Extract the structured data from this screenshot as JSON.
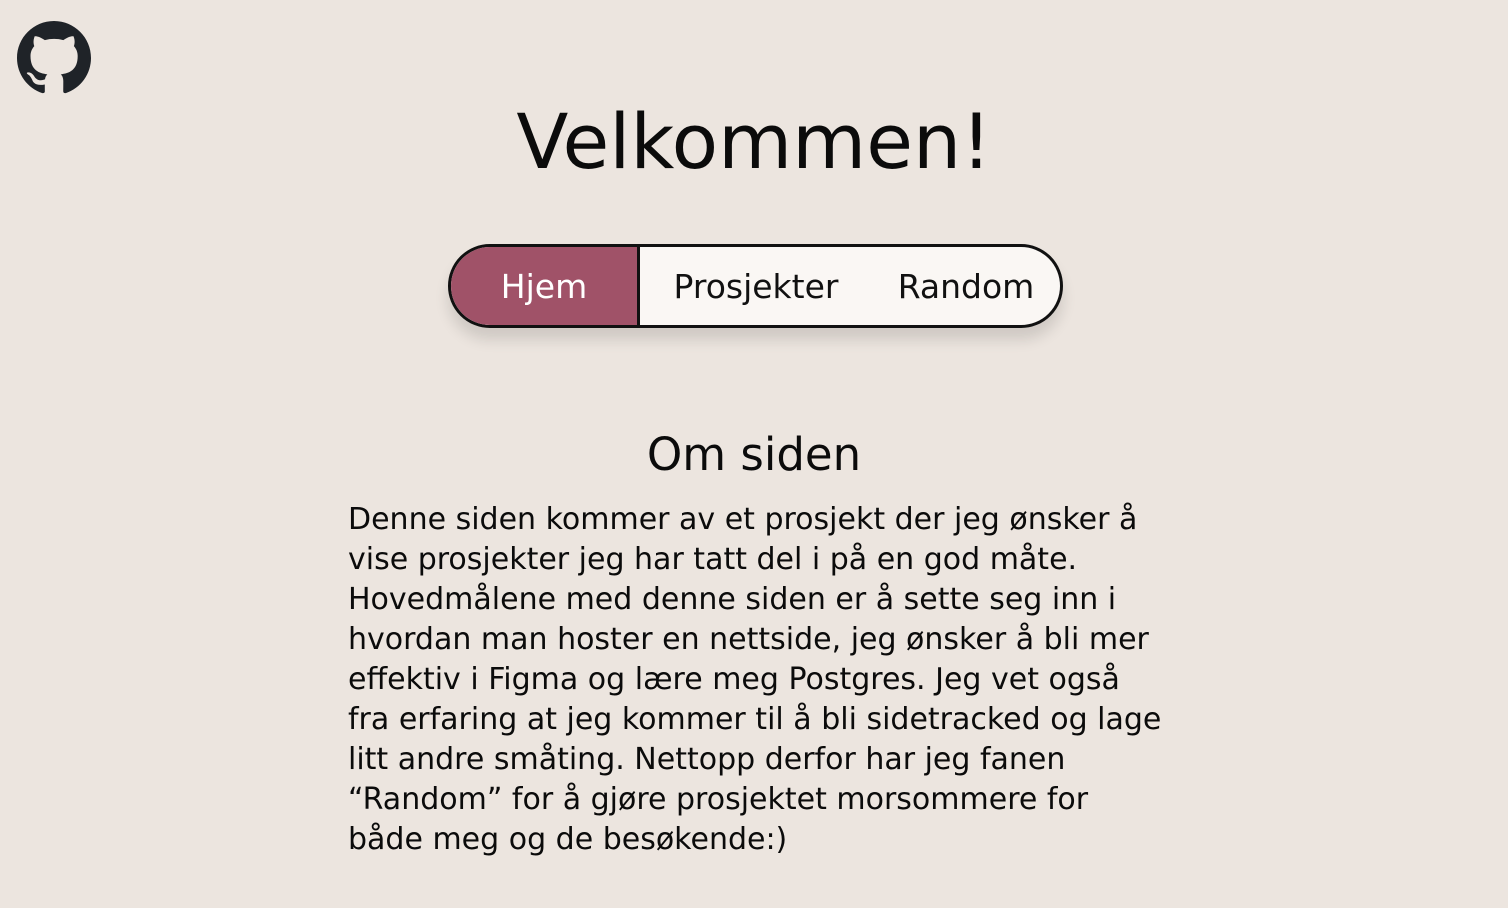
{
  "header": {
    "github_icon": "github-icon"
  },
  "page": {
    "title": "Velkommen!"
  },
  "nav": {
    "tabs": [
      {
        "label": "Hjem",
        "active": true
      },
      {
        "label": "Prosjekter",
        "active": false
      },
      {
        "label": "Random",
        "active": false
      }
    ]
  },
  "about": {
    "heading": "Om siden",
    "text": "Denne siden kommer av et prosjekt der jeg ønsker å\nvise prosjekter jeg har tatt del i på en god måte.\nHovedmålene med denne siden er å sette seg inn i\nhvordan man hoster en nettside, jeg ønsker å bli mer\neffektiv i Figma og lære meg Postgres. Jeg vet også\nfra erfaring at jeg kommer til å bli sidetracked og lage\nlitt andre småting. Nettopp derfor har jeg fanen\n“Random” for å gjøre prosjektet morsommere for\nbåde meg og de besøkende:)"
  },
  "colors": {
    "background": "#ece5df",
    "accent": "#a05268",
    "nav_background": "#faf7f4",
    "text": "#0b0b0b"
  }
}
